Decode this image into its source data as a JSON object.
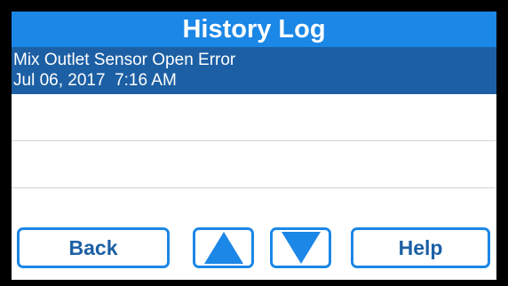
{
  "header": {
    "title": "History Log"
  },
  "log": {
    "entries": [
      {
        "event": "Mix Outlet Sensor Open Error",
        "timestamp": "Jul 06, 2017  7:16 AM",
        "selected": true
      }
    ]
  },
  "buttons": {
    "back_label": "Back",
    "up_icon": "up-arrow",
    "down_icon": "down-arrow",
    "help_label": "Help"
  },
  "colors": {
    "title_bar": "#1b87e6",
    "selected_row": "#1c5fa4",
    "button_border": "#1b87e6",
    "button_text": "#1c5fa4",
    "bezel": "#000000"
  }
}
